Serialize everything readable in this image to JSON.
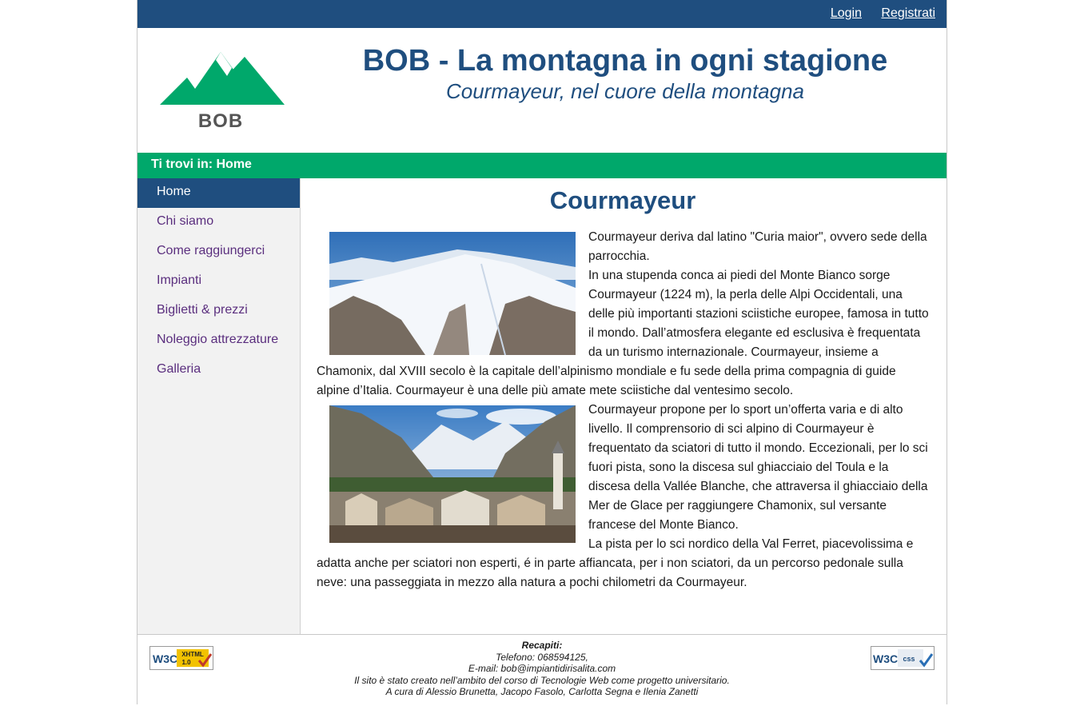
{
  "topbar": {
    "login": "Login",
    "register": "Registrati"
  },
  "header": {
    "logo_text": "BOB",
    "title": "BOB - La montagna in ogni stagione",
    "subtitle": "Courmayeur, nel cuore della montagna"
  },
  "breadcrumb": "Ti trovi in: Home",
  "nav": {
    "items": [
      {
        "label": "Home",
        "active": true
      },
      {
        "label": "Chi siamo"
      },
      {
        "label": "Come raggiungerci"
      },
      {
        "label": "Impianti"
      },
      {
        "label": "Biglietti & prezzi"
      },
      {
        "label": "Noleggio attrezzature"
      },
      {
        "label": "Galleria"
      }
    ]
  },
  "content": {
    "title": "Courmayeur",
    "p1a": "Courmayeur deriva dal latino \"Curia maior\", ovvero sede della parrocchia.",
    "p1b": "In una stupenda conca ai piedi del Monte Bianco sorge Courmayeur (1224 m), la perla delle Alpi Occidentali, una delle più importanti stazioni sciistiche europee, famosa in tutto il mondo. Dall’atmosfera elegante ed esclusiva è frequentata da un turismo internazionale. Courmayeur, insieme a Chamonix, dal XVIII secolo è la capitale dell’alpinismo mondiale e fu sede della prima compagnia di guide alpine d’Italia. Courmayeur è una delle più amate mete sciistiche dal ventesimo secolo.",
    "p2a": "Courmayeur propone per lo sport un’offerta varia e di alto livello. Il comprensorio di sci alpino di Courmayeur è frequentato da sciatori di tutto il mondo. Eccezionali, per lo sci fuori pista, sono la discesa sul ghiacciaio del Toula e la discesa della Vallée Blanche, che attraversa il ghiacciaio della Mer de Glace per raggiungere Chamonix, sul versante francese del Monte Bianco.",
    "p2b": "La pista per lo sci nordico della Val Ferret, piacevolissima e adatta anche per sciatori non esperti, é in parte affiancata, per i non sciatori, da un percorso pedonale sulla neve: una passeggiata in mezzo alla natura a pochi chilometri da Courmayeur."
  },
  "footer": {
    "heading": "Recapiti:",
    "phone": "Telefono: 068594125,",
    "email": "E-mail: bob@impiantidirisalita.com",
    "note": "Il sito è stato creato nell’ambito del corso di Tecnologie Web come progetto universitario.",
    "authors": "A cura di Alessio Brunetta, Jacopo Fasolo, Carlotta Segna e Ilenia Zanetti",
    "badge_xhtml": "W3C XHTML 1.0",
    "badge_css": "W3C CSS"
  },
  "colors": {
    "primary": "#1f4e7f",
    "accent": "#00a86b",
    "nav_link": "#5a2e7e"
  }
}
